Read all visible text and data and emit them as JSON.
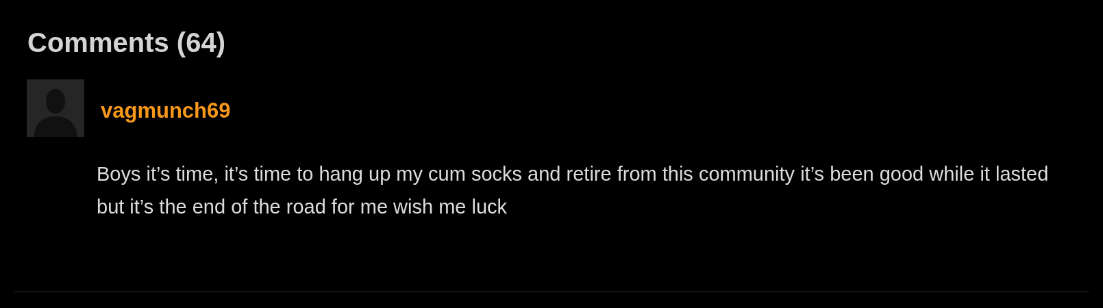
{
  "heading": "Comments (64)",
  "comments": [
    {
      "username": "vagmunch69",
      "text": "Boys it’s time, it’s time to hang up my cum socks and retire from this community it’s been good while it lasted but it’s the end of the road for me wish me luck"
    }
  ]
}
